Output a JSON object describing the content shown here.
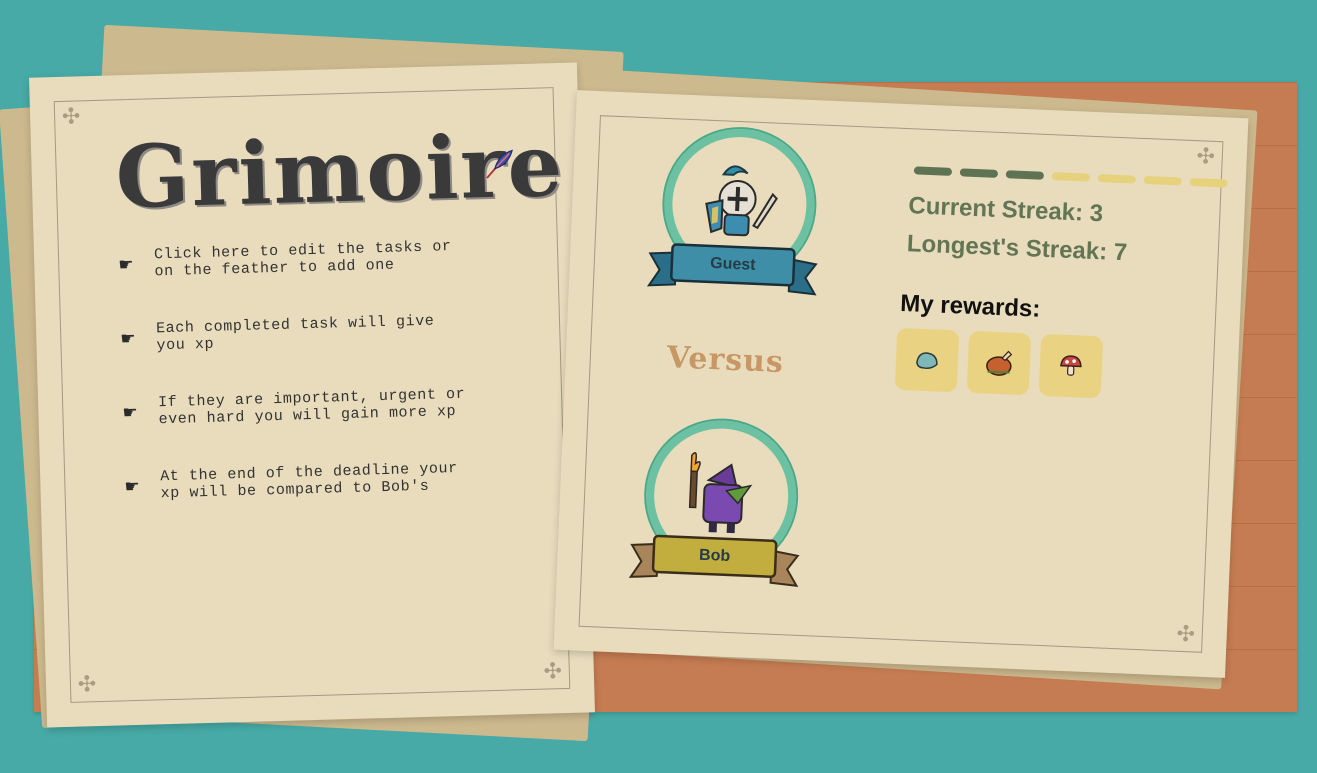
{
  "app": {
    "title": "Grimoire"
  },
  "instructions": [
    {
      "icon": "pointing-hand-icon",
      "glyph": "☛",
      "text": "Click here to edit the tasks or\non the feather to add one"
    },
    {
      "icon": "pointing-hand-icon",
      "glyph": "☛",
      "text": "Each completed task will give\nyou xp"
    },
    {
      "icon": "pointing-hand-icon",
      "glyph": "☛",
      "text": "If they are important, urgent or\neven hard you will gain more xp"
    },
    {
      "icon": "pointing-hand-icon",
      "glyph": "☛",
      "text": "At the end of the deadline your\nxp will be compared to Bob's"
    }
  ],
  "players": {
    "player": {
      "name": "Guest",
      "sprite": "knight-icon",
      "banner_color": "#3f8ea8"
    },
    "opponent": {
      "name": "Bob",
      "sprite": "goblin-torch-icon",
      "banner_color": "#c1ae3f"
    }
  },
  "versus_label": "Versus",
  "streak": {
    "current_label": "Current Streak: 3",
    "longest_label": "Longest's Streak: 7",
    "current": 3,
    "longest": 7,
    "filled_color": "#5e7353",
    "empty_color": "#e6d27d"
  },
  "rewards": {
    "title": "My rewards:",
    "items": [
      {
        "icon": "stone-icon"
      },
      {
        "icon": "roast-chicken-icon"
      },
      {
        "icon": "mushroom-icon"
      }
    ]
  },
  "colors": {
    "background": "#47aaa6",
    "board": "#c67c52",
    "paper": "#e8dcbc",
    "streak_text": "#627555"
  }
}
